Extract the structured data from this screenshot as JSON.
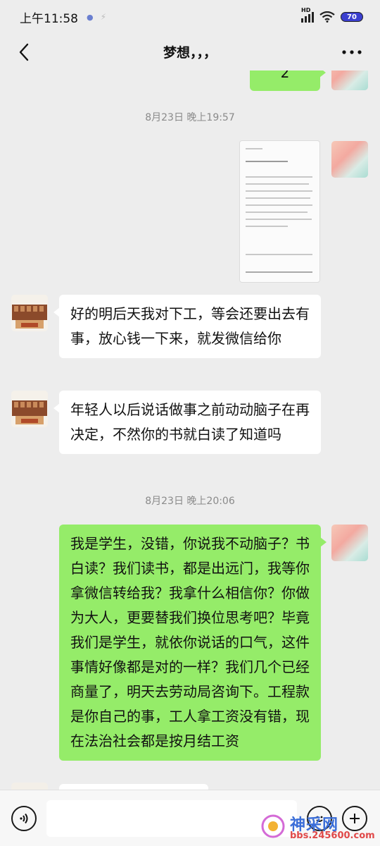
{
  "status_bar": {
    "time": "上午11:58",
    "network": "HD",
    "battery": "70"
  },
  "header": {
    "title": "梦想，，，"
  },
  "messages": {
    "top_partial": "2",
    "ts1": "8月23日 晚上19:57",
    "ts2": "8月23日 晚上20:06",
    "m1": "好的明后天我对下工，等会还要出去有事，放心钱一下来，就发微信给你",
    "m2": "年轻人以后说话做事之前动动脑子在再决定，不然你的书就白读了知道吗",
    "m3": "我是学生，没错，你说我不动脑子？书白读？我们读书，都是出远门，我等你拿微信转给我？我拿什么相信你？你做为大人，更要替我们换位思考吧？毕竟我们是学生，就依你说话的口气，这件事情好像都是对的一样？我们几个已经商量了，明天去劳动局咨询下。工程款是你自己的事，工人拿工资没有错，现在法治社会都是按月结工资"
  },
  "watermark": {
    "name": "神采网",
    "url": "bbs.245600.com"
  },
  "colors": {
    "sent_bubble": "#95ec69",
    "received_bubble": "#ffffff",
    "background": "#ededed"
  }
}
